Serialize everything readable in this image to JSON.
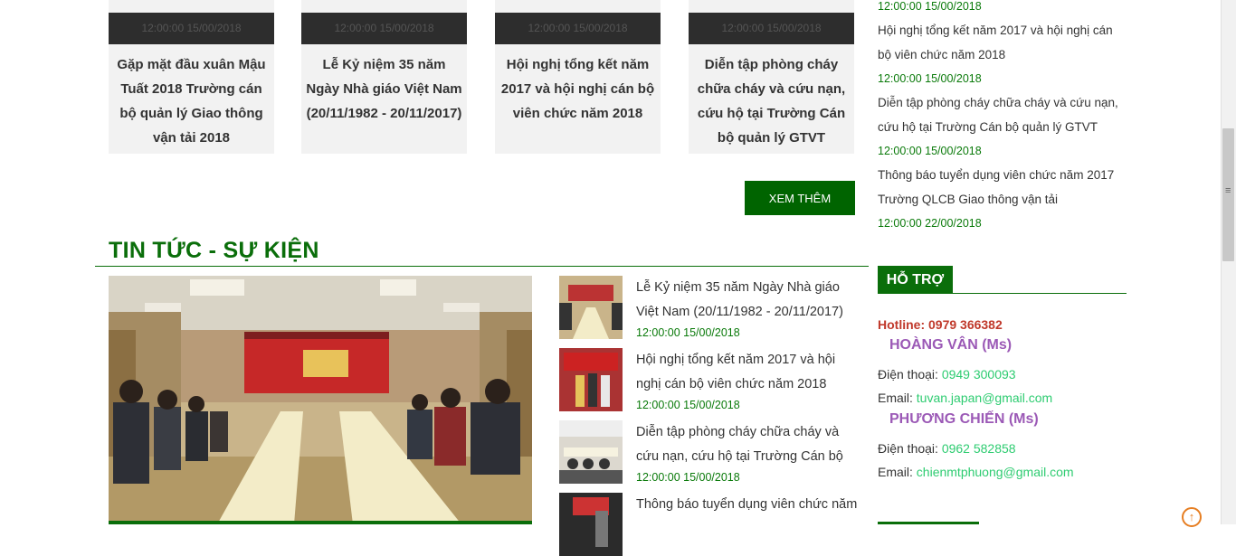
{
  "top_cards": [
    {
      "date": "12:00:00 15/00/2018",
      "title": "Gặp mặt đầu xuân Mậu Tuất 2018 Trường cán bộ quản lý Giao thông vận tải 2018"
    },
    {
      "date": "12:00:00 15/00/2018",
      "title": "Lễ Kỷ niệm 35 năm Ngày Nhà giáo Việt Nam (20/11/1982 - 20/11/2017)"
    },
    {
      "date": "12:00:00 15/00/2018",
      "title": "Hội nghị tổng kết năm 2017 và hội nghị cán bộ viên chức năm 2018"
    },
    {
      "date": "12:00:00 15/00/2018",
      "title": "Diễn tập phòng cháy chữa cháy và cứu nạn, cứu hộ tại Trường Cán bộ quản lý GTVT"
    }
  ],
  "more_button": "XEM THÊM",
  "section_title": "TIN TỨC - SỰ KIỆN",
  "news_list": [
    {
      "title": "Lễ Kỷ niệm 35 năm Ngày Nhà giáo Việt Nam (20/11/1982 - 20/11/2017)",
      "date": "12:00:00 15/00/2018"
    },
    {
      "title": "Hội nghị tổng kết năm 2017 và hội nghị cán bộ viên chức năm 2018",
      "date": "12:00:00 15/00/2018"
    },
    {
      "title": "Diễn tập phòng cháy chữa cháy và cứu nạn, cứu hộ tại Trường Cán bộ",
      "date": "12:00:00 15/00/2018"
    },
    {
      "title": "Thông báo tuyển dụng viên chức năm",
      "date": ""
    }
  ],
  "sidebar": {
    "top_date": "12:00:00 15/00/2018",
    "items": [
      {
        "title": "Hội nghị tổng kết năm 2017 và hội nghị cán bộ viên chức năm 2018",
        "date": "12:00:00 15/00/2018"
      },
      {
        "title": "Diễn tập phòng cháy chữa cháy và cứu nạn, cứu hộ tại Trường Cán bộ quản lý GTVT",
        "date": "12:00:00 15/00/2018"
      },
      {
        "title": "Thông báo tuyển dụng viên chức năm 2017 Trường QLCB Giao thông vận tải",
        "date": "12:00:00 22/00/2018"
      }
    ],
    "support_title": "HỖ TRỢ",
    "hotline": "Hotline: 0979 366382",
    "contacts": [
      {
        "name": "HOÀNG VÂN (Ms)",
        "phone_label": "Điện thoại:",
        "phone": "0949 300093",
        "email_label": "Email:",
        "email": "tuvan.japan@gmail.com"
      },
      {
        "name": "PHƯƠNG CHIẾN (Ms)",
        "phone_label": "Điện thoại:",
        "phone": "0962 582858",
        "email_label": "Email:",
        "email": "chienmtphuong@gmail.com"
      }
    ]
  }
}
